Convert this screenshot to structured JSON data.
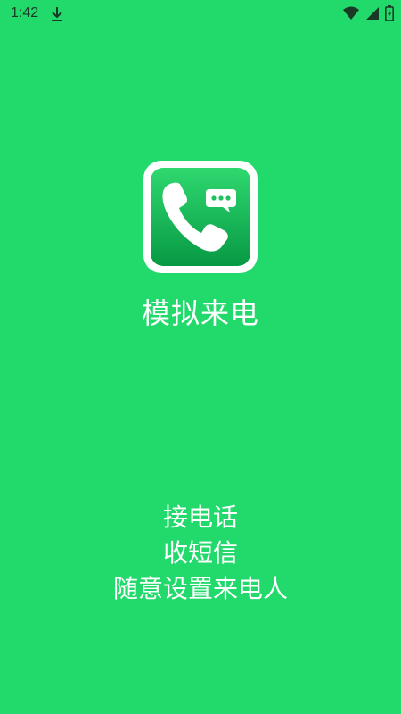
{
  "status_bar": {
    "time": "1:42",
    "icons": [
      "download-icon",
      "wifi-icon",
      "signal-icon",
      "battery-icon"
    ]
  },
  "splash": {
    "app_icon": "phone-with-message-icon",
    "app_name": "模拟来电",
    "features": [
      "接电话",
      "收短信",
      "随意设置来电人"
    ]
  },
  "colors": {
    "background": "#22d96b",
    "icon_gradient_top": "#2fd86f",
    "icon_gradient_bottom": "#079944",
    "text": "#ffffff"
  }
}
